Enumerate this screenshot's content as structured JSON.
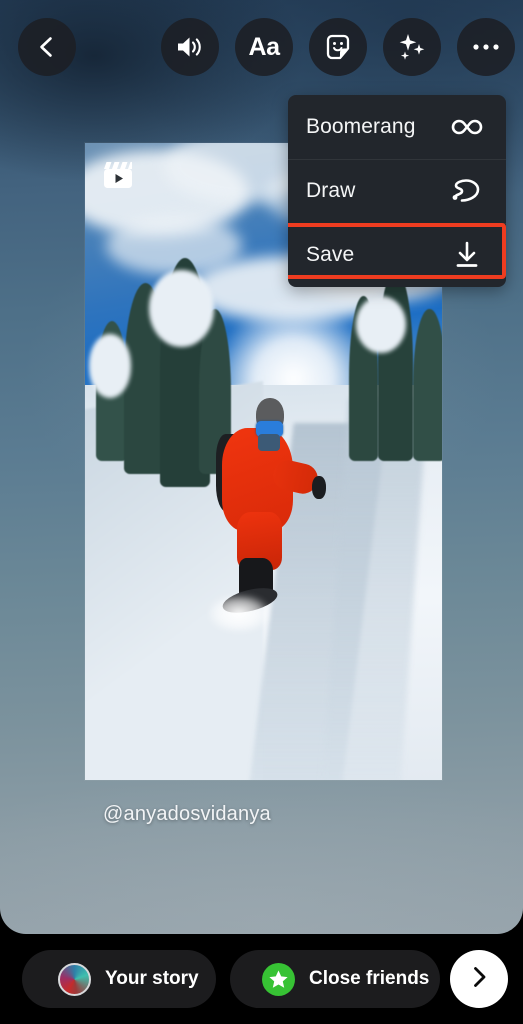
{
  "app": {
    "screen_name": "story-composer"
  },
  "toolbar": {
    "back": {
      "name": "back-button",
      "icon": "chevron-left-icon"
    },
    "sound": {
      "name": "sound-button",
      "icon": "speaker-wave-icon"
    },
    "text": {
      "name": "text-button",
      "icon": "aa-text-icon",
      "label": "Aa"
    },
    "sticker": {
      "name": "sticker-button",
      "icon": "sticker-smiley-icon"
    },
    "effects": {
      "name": "effects-button",
      "icon": "sparkles-icon"
    },
    "more": {
      "name": "more-options-button",
      "icon": "ellipsis-horizontal-icon"
    }
  },
  "menu": {
    "items": [
      {
        "label": "Boomerang",
        "icon": "infinity-icon",
        "highlighted": false
      },
      {
        "label": "Draw",
        "icon": "squiggle-pen-icon",
        "highlighted": false
      },
      {
        "label": "Save",
        "icon": "download-arrow-icon",
        "highlighted": true
      }
    ],
    "highlight_color": "#ef3c20"
  },
  "media": {
    "badge_icon": "reels-clapperboard-icon",
    "alt": "snowboarder in red jacket riding powder snow between snowy pine trees",
    "username": "@anyadosvidanya"
  },
  "bottom_bar": {
    "your_story_label": "Your story",
    "close_friends_label": "Close friends",
    "close_friends_color": "#37c234",
    "next": {
      "name": "next-button",
      "icon": "chevron-right-icon"
    }
  }
}
